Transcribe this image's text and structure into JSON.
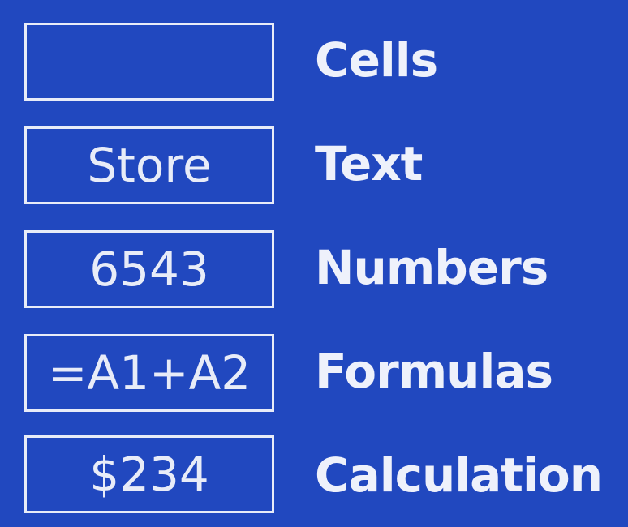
{
  "rows": [
    {
      "cell_value": "",
      "label": "Cells"
    },
    {
      "cell_value": "Store",
      "label": "Text"
    },
    {
      "cell_value": "6543",
      "label": "Numbers"
    },
    {
      "cell_value": "=A1+A2",
      "label": "Formulas"
    },
    {
      "cell_value": "$234",
      "label": "Calculation"
    }
  ],
  "colors": {
    "background": "#2148bf",
    "foreground": "#eef1fb"
  }
}
